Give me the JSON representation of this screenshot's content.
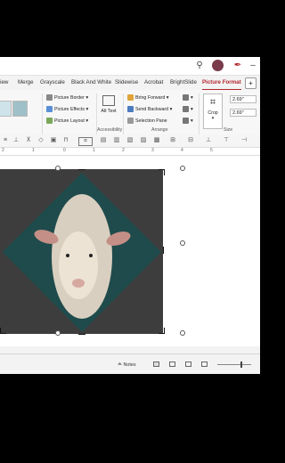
{
  "tabs": [
    {
      "label": "view"
    },
    {
      "label": "Merge"
    },
    {
      "label": "Grayscale"
    },
    {
      "label": "Black And White"
    },
    {
      "label": "Slidewise"
    },
    {
      "label": "Acrobat"
    },
    {
      "label": "BrightSlide"
    },
    {
      "label": "Picture Format"
    }
  ],
  "ribbon": {
    "picture_border": "Picture Border",
    "picture_effects": "Picture Effects",
    "picture_layout": "Picture Layout",
    "alt_text": "Alt Text",
    "bring_forward": "Bring Forward",
    "send_backward": "Send Backward",
    "selection_pane": "Selection Pane",
    "crop": "Crop",
    "height": "2.69\"",
    "width": "2.69\"",
    "group_accessibility": "Accessibility",
    "group_arrange": "Arrange",
    "group_size": "Size"
  },
  "ruler": [
    "2",
    "1",
    "0",
    "1",
    "2",
    "3",
    "4",
    "5"
  ],
  "status": {
    "notes": "Notes"
  },
  "colors": {
    "accent": "#b3262e",
    "slide_bg": "#3d3d3d",
    "diamond_bg": "#1f4b4c"
  }
}
